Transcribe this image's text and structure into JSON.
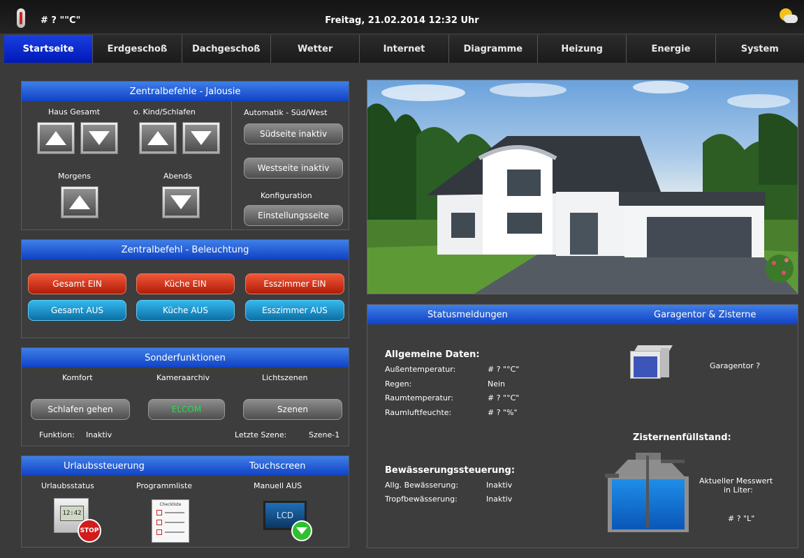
{
  "topbar": {
    "temperature": "# ? \"\"C\"",
    "datetime": "Freitag, 21.02.2014 12:32 Uhr"
  },
  "tabs": [
    {
      "label": "Startseite",
      "active": true
    },
    {
      "label": "Erdgeschoß"
    },
    {
      "label": "Dachgeschoß"
    },
    {
      "label": "Wetter"
    },
    {
      "label": "Internet"
    },
    {
      "label": "Diagramme"
    },
    {
      "label": "Heizung"
    },
    {
      "label": "Energie"
    },
    {
      "label": "System"
    }
  ],
  "jalousie": {
    "title": "Zentralbefehle - Jalousie",
    "haus_gesamt": "Haus Gesamt",
    "kind_schlafen": "o. Kind/Schlafen",
    "morgens": "Morgens",
    "abends": "Abends",
    "automatik": "Automatik - Süd/West",
    "suedseite": "Südseite inaktiv",
    "westseite": "Westseite inaktiv",
    "konfiguration": "Konfiguration",
    "einstellungsseite": "Einstellungsseite"
  },
  "beleuchtung": {
    "title": "Zentralbefehl - Beleuchtung",
    "gesamt_ein": "Gesamt EIN",
    "kueche_ein": "Küche EIN",
    "esszimmer_ein": "Esszimmer EIN",
    "gesamt_aus": "Gesamt AUS",
    "kueche_aus": "Küche AUS",
    "esszimmer_aus": "Esszimmer AUS"
  },
  "sonder": {
    "title": "Sonderfunktionen",
    "komfort": "Komfort",
    "kameraarchiv": "Kameraarchiv",
    "lichtszenen": "Lichtszenen",
    "schlafen_gehen": "Schlafen gehen",
    "elcom": "ELCOM",
    "szenen": "Szenen",
    "funktion_label": "Funktion:",
    "funktion_value": "Inaktiv",
    "letzte_szene_label": "Letzte Szene:",
    "letzte_szene_value": "Szene-1"
  },
  "urlaub": {
    "title": "Urlaubssteuerung",
    "touchscreen": "Touchscreen",
    "urlaubsstatus": "Urlaubsstatus",
    "programmliste": "Programmliste",
    "manuell_aus": "Manuell AUS",
    "clock_text": "12:42",
    "stop_text": "STOP",
    "lcd_text": "LCD",
    "checklist_title": "Checkliste"
  },
  "status": {
    "title_left": "Statusmeldungen",
    "title_right": "Garagentor & Zisterne",
    "allgemein": "Allgemeine Daten:",
    "aussen_label": "Außentemperatur:",
    "aussen_value": "# ? \"°C\"",
    "regen_label": "Regen:",
    "regen_value": "Nein",
    "raum_label": "Raumtemperatur:",
    "raum_value": "# ? \"°C\"",
    "feuchte_label": "Raumluftfeuchte:",
    "feuchte_value": "# ? \"%\"",
    "bewaesserung": "Bewässerungssteuerung:",
    "allg_label": "Allg. Bewässerung:",
    "allg_value": "Inaktiv",
    "tropf_label": "Tropfbewässerung:",
    "tropf_value": "Inaktiv",
    "garagentor": "Garagentor ?",
    "zisterne": "Zisternenfüllstand:",
    "messwert_1": "Aktueller Messwert",
    "messwert_2": "in Liter:",
    "liter_value": "# ? \"L\""
  }
}
